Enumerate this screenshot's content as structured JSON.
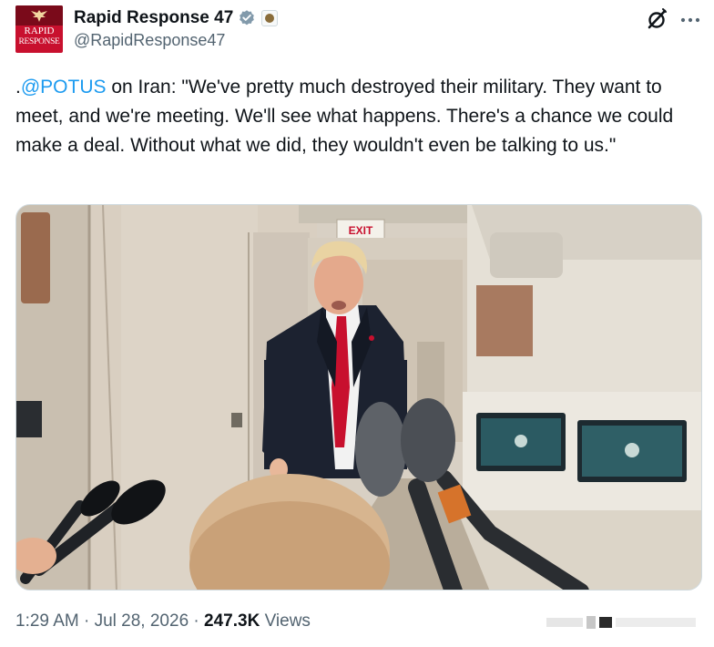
{
  "account": {
    "name": "Rapid Response 47",
    "handle": "@RapidResponse47",
    "avatar_line1": "RAPID",
    "avatar_line2": "RESPONSE"
  },
  "tweet": {
    "prefix": ".",
    "mention": "@POTUS",
    "body": " on Iran: \"We've pretty much destroyed their military. They want to meet, and we're meeting. We'll see what happens. There's a chance we could make a deal. Without what we did, they wouldn't even be talking to us.\""
  },
  "media": {
    "exit_sign": "EXIT"
  },
  "footer": {
    "time": "1:29 AM",
    "sep1": " · ",
    "date": "Jul 28, 2026",
    "sep2": " · ",
    "views_count": "247.3K",
    "views_label": " Views"
  },
  "icons": {
    "verified": "verified-badge-icon",
    "grok": "grok-icon",
    "more": "more-icon"
  },
  "colors": {
    "link": "#1d9bf0",
    "verified": "#829aab",
    "avatar_bg": "#c8102e",
    "secondary_text": "#536471"
  }
}
